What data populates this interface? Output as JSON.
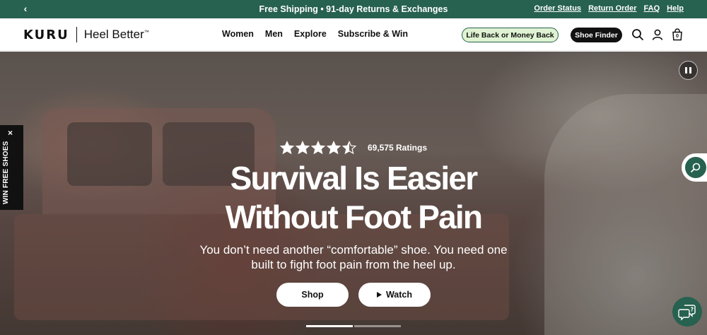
{
  "announcement": {
    "prev_glyph": "‹",
    "message": "Free Shipping • 91-day Returns & Exchanges",
    "links": [
      "Order Status",
      "Return Order",
      "FAQ",
      "Help"
    ]
  },
  "header": {
    "logo": {
      "brand": "KURU",
      "tagline": "Heel Better",
      "trademark": "™"
    },
    "nav": [
      "Women",
      "Men",
      "Explore",
      "Subscribe & Win"
    ],
    "life_back_label": "Life Back or Money Back",
    "shoe_finder_label": "Shoe Finder",
    "icons": [
      "search-icon",
      "account-icon",
      "cart-icon"
    ],
    "cart_count": "0"
  },
  "hero": {
    "rating_stars": 4.5,
    "rating_text": "69,575 Ratings",
    "headline_line1": "Survival Is Easier",
    "headline_line2": "Without Foot Pain",
    "subheadline_line1": "You don’t need another “comfortable” shoe. You need one",
    "subheadline_line2": "built to fight foot pain from the heel up.",
    "shop_label": "Shop",
    "watch_label": "Watch",
    "slides_total": 2,
    "slide_active": 1
  },
  "side_tab": {
    "label": "WIN FREE SHOES",
    "close_glyph": "×"
  },
  "colors": {
    "brand_green": "#27614f",
    "life_back_bg": "#dff3d2",
    "dark": "#111111",
    "white": "#ffffff"
  }
}
